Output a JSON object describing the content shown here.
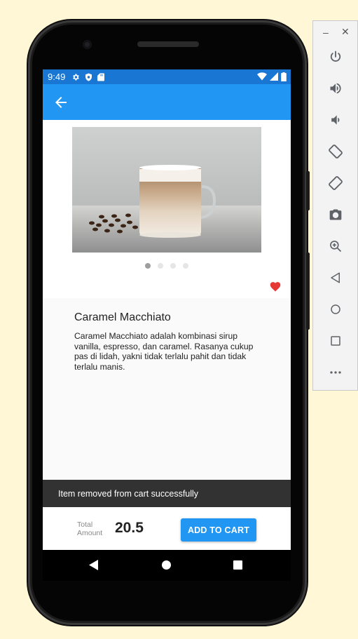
{
  "status_bar": {
    "time": "9:49"
  },
  "product": {
    "name": "Caramel Macchiato",
    "description": "Caramel Macchiato adalah kombinasi sirup vanilla, espresso, dan caramel. Rasanya cukup pas di lidah, yakni tidak terlalu pahit dan tidak terlalu manis.",
    "carousel": {
      "total_pages": 4,
      "active_page": 1
    },
    "favorited": true
  },
  "snackbar": {
    "message": "Item removed from cart successfully"
  },
  "footer": {
    "total_label": "Total Amount",
    "total_value": "20.5",
    "add_to_cart_label": "ADD TO CART"
  },
  "colors": {
    "primary": "#2196f3",
    "status_bar": "#1976d2",
    "favorite": "#e53935",
    "snackbar": "#323232"
  },
  "emulator_controls": {
    "window_buttons": [
      "minimize-icon",
      "close-icon"
    ],
    "tools": [
      "power-icon",
      "volume-up-icon",
      "volume-down-icon",
      "rotate-left-icon",
      "rotate-right-icon",
      "camera-icon",
      "zoom-icon",
      "back-icon",
      "home-icon",
      "overview-icon",
      "more-icon"
    ]
  }
}
